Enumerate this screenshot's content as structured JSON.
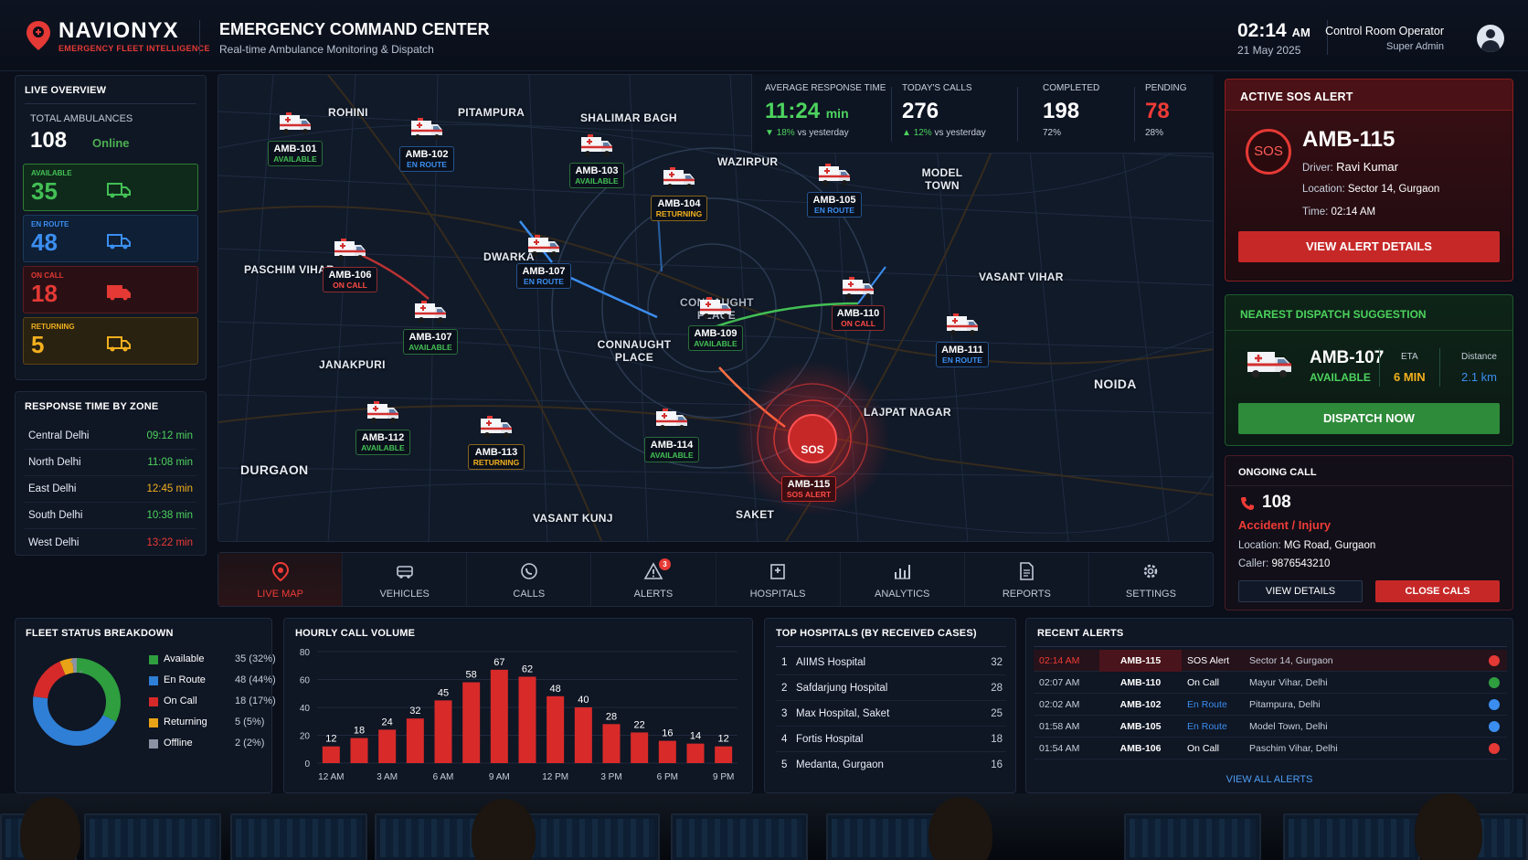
{
  "header": {
    "brand_name": "NAVIONYX",
    "brand_tagline": "EMERGENCY FLEET INTELLIGENCE",
    "title": "EMERGENCY COMMAND CENTER",
    "subtitle": "Real-time Ambulance Monitoring & Dispatch",
    "time": "02:14",
    "time_suffix": "AM",
    "date": "21 May 2025",
    "operator_name": "Control Room Operator",
    "operator_role": "Super Admin"
  },
  "live_overview": {
    "title": "LIVE OVERVIEW",
    "total_label": "TOTAL AMBULANCES",
    "total_value": "108",
    "online_label": "Online",
    "stats": [
      {
        "label": "AVAILABLE",
        "value": "35",
        "color": "#43c055"
      },
      {
        "label": "EN ROUTE",
        "value": "48",
        "color": "#3b8ef0"
      },
      {
        "label": "ON CALL",
        "value": "18",
        "color": "#e53935"
      },
      {
        "label": "RETURNING",
        "value": "5",
        "color": "#f2b01e"
      }
    ]
  },
  "response_time": {
    "title": "RESPONSE TIME BY ZONE",
    "zones": [
      {
        "zone": "Central Delhi",
        "time": "09:12 min",
        "color": "#4cd35e"
      },
      {
        "zone": "North Delhi",
        "time": "11:08 min",
        "color": "#4cd35e"
      },
      {
        "zone": "East Delhi",
        "time": "12:45 min",
        "color": "#f2b01e"
      },
      {
        "zone": "South Delhi",
        "time": "10:38 min",
        "color": "#4cd35e"
      },
      {
        "zone": "West Delhi",
        "time": "13:22 min",
        "color": "#ef3b36"
      }
    ]
  },
  "kpis": {
    "avg_label": "AVERAGE RESPONSE TIME",
    "avg_value": "11:24",
    "avg_unit": "min",
    "avg_change": "18%",
    "avg_change_suffix": "vs yesterday",
    "calls_label": "TODAY'S CALLS",
    "calls_value": "276",
    "calls_change": "12%",
    "calls_change_suffix": "vs yesterday",
    "completed_label": "COMPLETED",
    "completed_value": "198",
    "completed_pct": "72%",
    "pending_label": "PENDING",
    "pending_value": "78",
    "pending_pct": "28%"
  },
  "map": {
    "areas": [
      "ROHINI",
      "PITAMPURA",
      "SHALIMAR BAGH",
      "WAZIRPUR",
      "MODEL TOWN",
      "PASCHIM VIHAR",
      "JANAKPURI",
      "DWARKA",
      "CONNAUGHT PLACE",
      "CONNAUGHT PLACE",
      "VASANT VIHAR",
      "NOIDA",
      "LAJPAT NAGAR",
      "DURGAON",
      "VASANT KUNJ",
      "SAKET"
    ],
    "ambulances": [
      {
        "id": "AMB-101",
        "status": "AVAILABLE"
      },
      {
        "id": "AMB-102",
        "status": "EN ROUTE"
      },
      {
        "id": "AMB-103",
        "status": "AVAILABLE"
      },
      {
        "id": "AMB-104",
        "status": "RETURNING"
      },
      {
        "id": "AMB-105",
        "status": "EN ROUTE"
      },
      {
        "id": "AMB-106",
        "status": "ON CALL"
      },
      {
        "id": "AMB-107",
        "status": "EN ROUTE"
      },
      {
        "id": "AMB-107",
        "status": "AVAILABLE"
      },
      {
        "id": "AMB-109",
        "status": "AVAILABLE"
      },
      {
        "id": "AMB-110",
        "status": "ON CALL"
      },
      {
        "id": "AMB-111",
        "status": "EN ROUTE"
      },
      {
        "id": "AMB-112",
        "status": "AVAILABLE"
      },
      {
        "id": "AMB-113",
        "status": "RETURNING"
      },
      {
        "id": "AMB-114",
        "status": "AVAILABLE"
      },
      {
        "id": "AMB-115",
        "status": "SOS ALERT"
      }
    ],
    "sos_marker": "SOS"
  },
  "nav": [
    {
      "label": "LIVE MAP",
      "icon": "map-pin-icon"
    },
    {
      "label": "VEHICLES",
      "icon": "vehicle-icon"
    },
    {
      "label": "CALLS",
      "icon": "phone-icon"
    },
    {
      "label": "ALERTS",
      "icon": "alert-triangle-icon",
      "badge": "3"
    },
    {
      "label": "HOSPITALS",
      "icon": "hospital-icon"
    },
    {
      "label": "ANALYTICS",
      "icon": "bar-chart-icon"
    },
    {
      "label": "REPORTS",
      "icon": "document-icon"
    },
    {
      "label": "SETTINGS",
      "icon": "gear-icon"
    }
  ],
  "sos_alert": {
    "title": "ACTIVE SOS ALERT",
    "badge": "SOS",
    "id": "AMB-115",
    "driver_label": "Driver:",
    "driver": "Ravi Kumar",
    "location_label": "Location:",
    "location": "Sector 14, Gurgaon",
    "time_label": "Time:",
    "time": "02:14 AM",
    "button": "VIEW ALERT DETAILS"
  },
  "nearest": {
    "title": "NEAREST DISPATCH SUGGESTION",
    "id": "AMB-107",
    "status": "AVAILABLE",
    "eta_label": "ETA",
    "eta": "6 MIN",
    "distance_label": "Distance",
    "distance": "2.1 km",
    "button": "DISPATCH NOW"
  },
  "ongoing_call": {
    "title": "ONGOING CALL",
    "number": "108",
    "type": "Accident / Injury",
    "location_label": "Location:",
    "location": "MG Road, Gurgaon",
    "caller_label": "Caller:",
    "caller": "9876543210",
    "view_button": "VIEW DETAILS",
    "close_button": "CLOSE CALS"
  },
  "fleet_status": {
    "title": "FLEET STATUS BREAKDOWN",
    "items": [
      {
        "name": "Available",
        "value": "35 (32%)",
        "count": 35,
        "color": "#2e9e3f"
      },
      {
        "name": "En Route",
        "value": "48 (44%)",
        "count": 48,
        "color": "#2f7fd6"
      },
      {
        "name": "On Call",
        "value": "18 (17%)",
        "count": 18,
        "color": "#d62a2a"
      },
      {
        "name": "Returning",
        "value": "5 (5%)",
        "count": 5,
        "color": "#e8a317"
      },
      {
        "name": "Offline",
        "value": "2 (2%)",
        "count": 2,
        "color": "#8a93a3"
      }
    ]
  },
  "chart_data": {
    "type": "bar",
    "title": "HOURLY CALL VOLUME",
    "values": [
      12,
      18,
      24,
      32,
      45,
      58,
      67,
      62,
      48,
      40,
      28,
      22,
      16,
      14,
      12
    ],
    "x_tick_labels": [
      "12 AM",
      "3 AM",
      "6 AM",
      "9 AM",
      "12 PM",
      "3 PM",
      "6 PM",
      "9 PM"
    ],
    "y_ticks": [
      0,
      20,
      40,
      60,
      80
    ],
    "ylim": [
      0,
      80
    ],
    "color": "#d92a2a",
    "grid": true
  },
  "top_hospitals": {
    "title": "TOP HOSPITALS (BY RECEIVED CASES)",
    "rows": [
      {
        "rank": "1",
        "name": "AIIMS Hospital",
        "count": "32"
      },
      {
        "rank": "2",
        "name": "Safdarjung Hospital",
        "count": "28"
      },
      {
        "rank": "3",
        "name": "Max Hospital, Saket",
        "count": "25"
      },
      {
        "rank": "4",
        "name": "Fortis Hospital",
        "count": "18"
      },
      {
        "rank": "5",
        "name": "Medanta, Gurgaon",
        "count": "16"
      }
    ]
  },
  "recent_alerts": {
    "title": "RECENT ALERTS",
    "rows": [
      {
        "time": "02:14 AM",
        "id": "AMB-115",
        "status": "SOS Alert",
        "location": "Sector 14, Gurgaon",
        "status_color": "#ffffff",
        "dot": "#e53935"
      },
      {
        "time": "02:07 AM",
        "id": "AMB-110",
        "status": "On Call",
        "location": "Mayur Vihar, Delhi",
        "status_color": "#ffffff",
        "dot": "#2e9e3f"
      },
      {
        "time": "02:02 AM",
        "id": "AMB-102",
        "status": "En Route",
        "location": "Pitampura, Delhi",
        "status_color": "#3b8ef0",
        "dot": "#3b8ef0"
      },
      {
        "time": "01:58 AM",
        "id": "AMB-105",
        "status": "En Route",
        "location": "Model Town, Delhi",
        "status_color": "#3b8ef0",
        "dot": "#3b8ef0"
      },
      {
        "time": "01:54 AM",
        "id": "AMB-106",
        "status": "On Call",
        "location": "Paschim Vihar, Delhi",
        "status_color": "#ffffff",
        "dot": "#e53935"
      }
    ],
    "view_all": "VIEW ALL ALERTS"
  }
}
